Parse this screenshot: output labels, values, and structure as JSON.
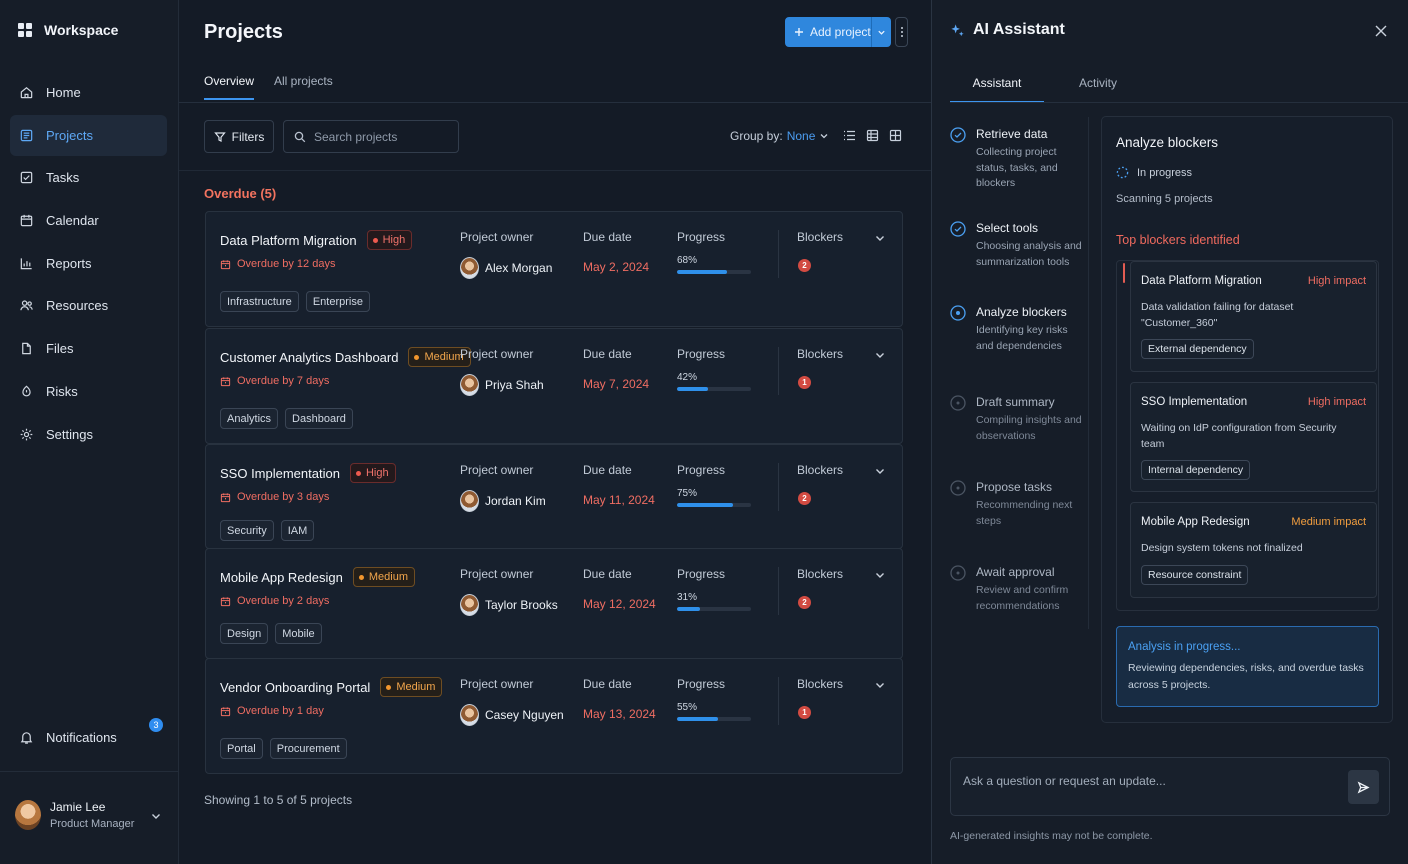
{
  "sidebar": {
    "brand": "Workspace",
    "items": [
      {
        "label": "Home",
        "icon": "home-icon"
      },
      {
        "label": "Projects",
        "icon": "projects-icon",
        "active": true
      },
      {
        "label": "Tasks",
        "icon": "tasks-icon"
      },
      {
        "label": "Calendar",
        "icon": "calendar-icon"
      },
      {
        "label": "Reports",
        "icon": "reports-icon"
      },
      {
        "label": "Resources",
        "icon": "resources-icon"
      },
      {
        "label": "Files",
        "icon": "file-icon"
      },
      {
        "label": "Risks",
        "icon": "risk-icon"
      },
      {
        "label": "Settings",
        "icon": "gear-icon"
      }
    ],
    "notifications": {
      "label": "Notifications",
      "count": "3"
    },
    "user": {
      "name": "Jamie Lee",
      "role": "Product Manager"
    }
  },
  "main": {
    "title": "Projects",
    "add_button": "Add project",
    "tabs": [
      {
        "label": "Overview",
        "active": true
      },
      {
        "label": "All projects",
        "active": false
      }
    ],
    "filters_label": "Filters",
    "search_placeholder": "Search projects",
    "group_by_label": "Group by:",
    "group_by_value": "None",
    "section_title": "Overdue (5)",
    "column_labels": {
      "owner": "Project owner",
      "due": "Due date",
      "progress": "Progress",
      "blockers": "Blockers"
    },
    "projects": [
      {
        "name": "Data Platform Migration",
        "priority": "High",
        "overdue": "Overdue by 12 days",
        "tags": [
          "Infrastructure",
          "Enterprise"
        ],
        "owner": "Alex Morgan",
        "due": "May 2, 2024",
        "progress_label": "68%",
        "progress": 68,
        "blockers": "2"
      },
      {
        "name": "Customer Analytics Dashboard",
        "priority": "Medium",
        "overdue": "Overdue by 7 days",
        "tags": [
          "Analytics",
          "Dashboard"
        ],
        "owner": "Priya Shah",
        "due": "May 7, 2024",
        "progress_label": "42%",
        "progress": 42,
        "blockers": "1"
      },
      {
        "name": "SSO Implementation",
        "priority": "High",
        "overdue": "Overdue by 3 days",
        "tags": [
          "Security",
          "IAM"
        ],
        "owner": "Jordan Kim",
        "due": "May 11, 2024",
        "progress_label": "75%",
        "progress": 75,
        "blockers": "2"
      },
      {
        "name": "Mobile App Redesign",
        "priority": "Medium",
        "overdue": "Overdue by 2 days",
        "tags": [
          "Design",
          "Mobile"
        ],
        "owner": "Taylor Brooks",
        "due": "May 12, 2024",
        "progress_label": "31%",
        "progress": 31,
        "blockers": "2"
      },
      {
        "name": "Vendor Onboarding Portal",
        "priority": "Medium",
        "overdue": "Overdue by 1 day",
        "tags": [
          "Portal",
          "Procurement"
        ],
        "owner": "Casey Nguyen",
        "due": "May 13, 2024",
        "progress_label": "55%",
        "progress": 55,
        "blockers": "1"
      }
    ],
    "showing": "Showing 1 to 5 of 5 projects"
  },
  "assistant": {
    "title": "AI Assistant",
    "tabs": [
      {
        "label": "Assistant",
        "active": true
      },
      {
        "label": "Activity",
        "active": false
      }
    ],
    "steps": [
      {
        "title": "Retrieve data",
        "desc": "Collecting project status, tasks, and blockers",
        "state": "done"
      },
      {
        "title": "Select tools",
        "desc": "Choosing analysis and summarization tools",
        "state": "done"
      },
      {
        "title": "Analyze blockers",
        "desc": "Identifying key risks and dependencies",
        "state": "active"
      },
      {
        "title": "Draft summary",
        "desc": "Compiling insights and observations",
        "state": "pending"
      },
      {
        "title": "Propose tasks",
        "desc": "Recommending next steps",
        "state": "pending"
      },
      {
        "title": "Await approval",
        "desc": "Review and confirm recommendations",
        "state": "pending"
      }
    ],
    "panel": {
      "title": "Analyze blockers",
      "status": "In progress",
      "scanning": "Scanning 5 projects",
      "top_blockers_title": "Top blockers identified",
      "blockers": [
        {
          "project": "Data Platform Migration",
          "impact": "High impact",
          "level": "high",
          "desc": "Data validation failing for dataset \"Customer_360\"",
          "tag": "External dependency"
        },
        {
          "project": "SSO Implementation",
          "impact": "High impact",
          "level": "high",
          "desc": "Waiting on IdP configuration from Security team",
          "tag": "Internal dependency"
        },
        {
          "project": "Mobile App Redesign",
          "impact": "Medium impact",
          "level": "medium",
          "desc": "Design system tokens not finalized",
          "tag": "Resource constraint"
        }
      ],
      "analysis_title": "Analysis in progress...",
      "analysis_desc": "Reviewing dependencies, risks, and overdue tasks across 5 projects."
    },
    "ask_placeholder": "Ask a question or request an update...",
    "disclaimer": "AI-generated insights may not be complete."
  },
  "colors": {
    "accent": "#2f87dd",
    "danger": "#ef6d62",
    "warning": "#f2a64c"
  }
}
